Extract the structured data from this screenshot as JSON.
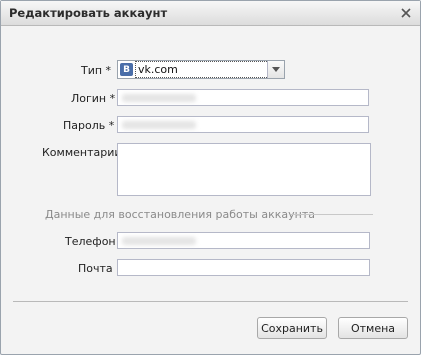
{
  "dialog": {
    "title": "Редактировать аккаунт",
    "close_icon": "close-icon"
  },
  "form": {
    "type_label": "Тип *",
    "type_value": "vk.com",
    "type_badge": "B",
    "login_label": "Логин *",
    "login_value": "",
    "password_label": "Пароль *",
    "password_value": "",
    "comments_label": "Комментарии",
    "comments_value": "",
    "recovery_section_label": "Данные для восстановления работы аккаунта",
    "phone_label": "Телефон",
    "phone_value": "",
    "email_label": "Почта",
    "email_value": ""
  },
  "buttons": {
    "save_label": "Сохранить",
    "cancel_label": "Отмена"
  },
  "colors": {
    "vk_badge": "#4a6ea9",
    "dialog_bg": "#f3f3f3",
    "field_border": "#b5b8c8"
  }
}
